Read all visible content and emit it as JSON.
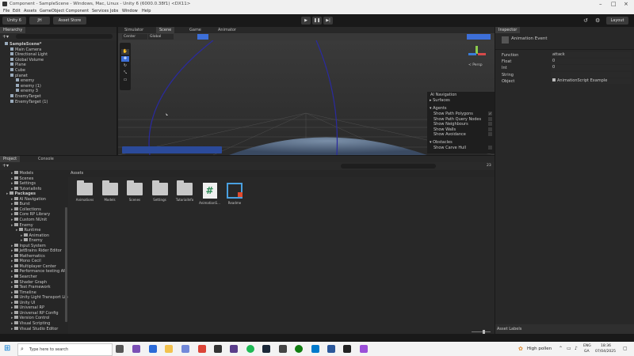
{
  "window": {
    "title": "Component - SampleScene - Windows, Mac, Linux - Unity 6 (6000.0.38f1) <DX11>"
  },
  "menu": [
    "File",
    "Edit",
    "Assets",
    "GameObject",
    "Component",
    "Services",
    "Jobs",
    "Window",
    "Help"
  ],
  "toolbar": {
    "unity_label": "Unity 6",
    "account": "JH",
    "asset_store": "Asset Store",
    "layout": "Layout"
  },
  "hierarchy": {
    "tab": "Hierarchy",
    "items": [
      {
        "label": "SampleScene*",
        "depth": 0
      },
      {
        "label": "Main Camera",
        "depth": 1
      },
      {
        "label": "Directional Light",
        "depth": 1
      },
      {
        "label": "Global Volume",
        "depth": 1
      },
      {
        "label": "Plane",
        "depth": 1
      },
      {
        "label": "Cube",
        "depth": 1
      },
      {
        "label": "planet",
        "depth": 1
      },
      {
        "label": "enemy",
        "depth": 2
      },
      {
        "label": "enemy (1)",
        "depth": 2
      },
      {
        "label": "enemy 3",
        "depth": 2
      },
      {
        "label": "EnemyTarget",
        "depth": 1
      },
      {
        "label": "EnemyTarget (1)",
        "depth": 1
      }
    ]
  },
  "scene_tabs": {
    "simulator": "Simulator",
    "scene": "Scene",
    "game": "Game",
    "animator": "Animator"
  },
  "scene_toolbar": {
    "pivot": "Center",
    "space": "Global",
    "persp": "< Persp"
  },
  "ai_nav": {
    "title": "AI Navigation",
    "surfaces": "Surfaces",
    "agents": "Agents",
    "agent_items": [
      "Show Path Polygons",
      "Show Path Query Nodes",
      "Show Neighbours",
      "Show Walls",
      "Show Avoidance"
    ],
    "obstacles": "Obstacles",
    "obstacle_items": [
      "Show Carve Hull"
    ]
  },
  "inspector": {
    "tab": "Inspector",
    "header": "Animation Event",
    "fields": [
      {
        "label": "Function",
        "value": "attack"
      },
      {
        "label": "Float",
        "value": "0"
      },
      {
        "label": "Int",
        "value": "0"
      },
      {
        "label": "String",
        "value": ""
      },
      {
        "label": "Object",
        "value": "AnimationScript Example"
      }
    ],
    "asset_labels": "Asset Labels"
  },
  "project": {
    "tabs": [
      "Project",
      "Console"
    ],
    "breadcrumb": "Assets",
    "count": "23",
    "tree": [
      {
        "label": "Models",
        "depth": 1
      },
      {
        "label": "Scenes",
        "depth": 1
      },
      {
        "label": "Settings",
        "depth": 1
      },
      {
        "label": "TutorialInfo",
        "depth": 1
      },
      {
        "label": "Packages",
        "depth": 0
      },
      {
        "label": "AI Navigation",
        "depth": 1
      },
      {
        "label": "Burst",
        "depth": 1
      },
      {
        "label": "Collections",
        "depth": 1
      },
      {
        "label": "Core RP Library",
        "depth": 1
      },
      {
        "label": "Custom NUnit",
        "depth": 1
      },
      {
        "label": "Enemy",
        "depth": 1
      },
      {
        "label": "Runtime",
        "depth": 2
      },
      {
        "label": "Animation",
        "depth": 3
      },
      {
        "label": "Enemy",
        "depth": 3
      },
      {
        "label": "Input System",
        "depth": 1
      },
      {
        "label": "JetBrains Rider Editor",
        "depth": 1
      },
      {
        "label": "Mathematics",
        "depth": 1
      },
      {
        "label": "Mono Cecil",
        "depth": 1
      },
      {
        "label": "Multiplayer Center",
        "depth": 1
      },
      {
        "label": "Performance testing API",
        "depth": 1
      },
      {
        "label": "Searcher",
        "depth": 1
      },
      {
        "label": "Shader Graph",
        "depth": 1
      },
      {
        "label": "Test Framework",
        "depth": 1
      },
      {
        "label": "Timeline",
        "depth": 1
      },
      {
        "label": "Unity Light Transport Libr",
        "depth": 1
      },
      {
        "label": "Unity UI",
        "depth": 1
      },
      {
        "label": "Universal RP",
        "depth": 1
      },
      {
        "label": "Universal RP Config",
        "depth": 1
      },
      {
        "label": "Version Control",
        "depth": 1
      },
      {
        "label": "Visual Scripting",
        "depth": 1
      },
      {
        "label": "Visual Studio Editor",
        "depth": 1
      }
    ],
    "assets": [
      {
        "label": "Animations",
        "kind": "folder"
      },
      {
        "label": "Models",
        "kind": "folder"
      },
      {
        "label": "Scenes",
        "kind": "folder"
      },
      {
        "label": "Settings",
        "kind": "folder"
      },
      {
        "label": "TutorialInfo",
        "kind": "folder"
      },
      {
        "label": "AnimationS...",
        "kind": "script"
      },
      {
        "label": "Readme",
        "kind": "readme"
      }
    ]
  },
  "taskbar": {
    "search_placeholder": "Type here to search",
    "weather": "High pollen",
    "lang1": "ENG",
    "lang2": "GA",
    "time": "18:36",
    "date": "07/04/2025"
  },
  "colors": {
    "accent": "#3d6fd8",
    "path": "#2a2aa0"
  }
}
